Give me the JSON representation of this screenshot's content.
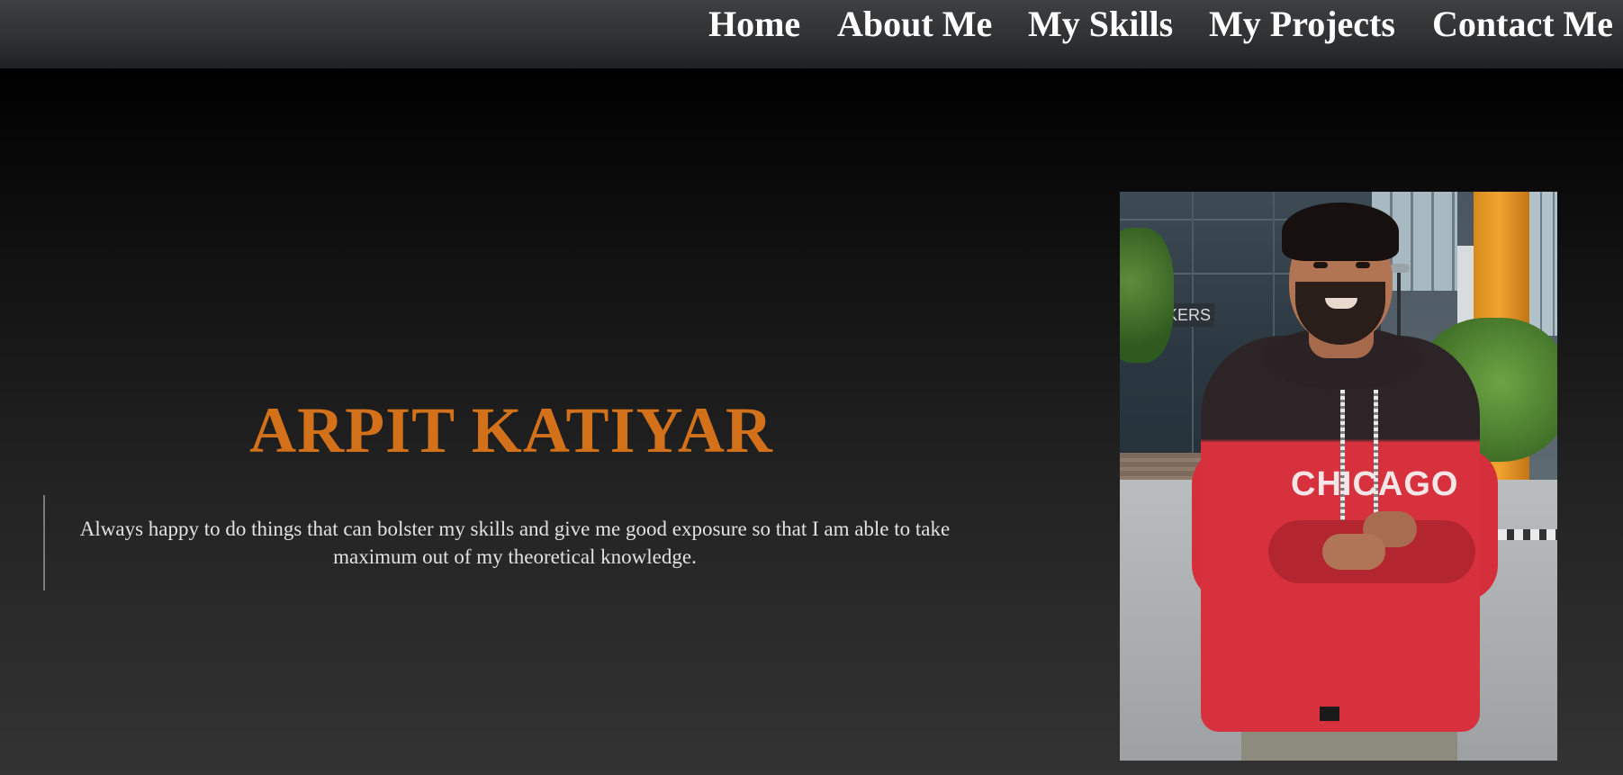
{
  "nav": {
    "links": [
      {
        "label": "Home"
      },
      {
        "label": "About Me"
      },
      {
        "label": "My Skills"
      },
      {
        "label": "My Projects"
      },
      {
        "label": "Contact Me"
      }
    ]
  },
  "hero": {
    "name": "ARPIT KATIYAR",
    "tagline": "Always happy to do things that can bolster my skills and give me good exposure so that I am able to take maximum out of my theoretical knowledge.",
    "photo": {
      "sign_text": "ACKERS",
      "shirt_text": "CHICAGO"
    }
  },
  "colors": {
    "name_accent": "#d2711a",
    "nav_text": "#ffffff",
    "tagline_text": "#e2e2e2"
  }
}
